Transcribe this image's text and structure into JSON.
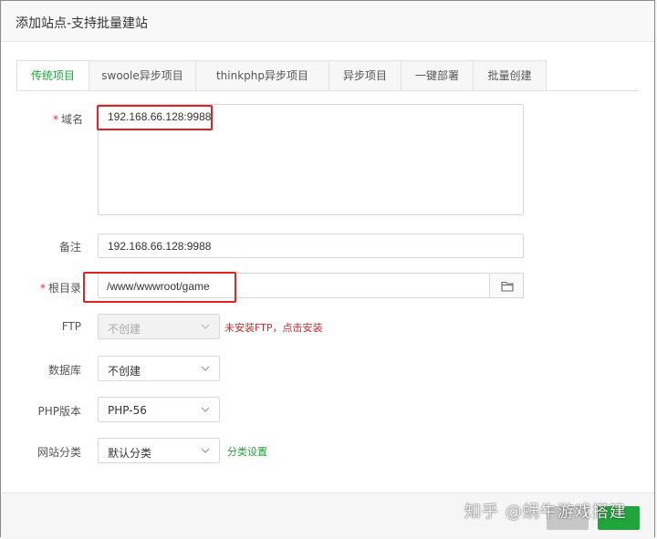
{
  "dialog": {
    "title": "添加站点-支持批量建站",
    "close_icon": "close-icon"
  },
  "tabs": [
    {
      "label": "传统项目",
      "active": true
    },
    {
      "label": "swoole异步项目",
      "active": false
    },
    {
      "label": "thinkphp异步项目",
      "active": false
    },
    {
      "label": "异步项目",
      "active": false
    },
    {
      "label": "一键部署",
      "active": false
    },
    {
      "label": "批量创建",
      "active": false
    }
  ],
  "form": {
    "required_mark": "*",
    "domain": {
      "label": "域名",
      "value": "192.168.66.128:9988"
    },
    "remark": {
      "label": "备注",
      "value": "192.168.66.128:9988"
    },
    "root_dir": {
      "label": "根目录",
      "value": "/www/wwwroot/game",
      "browse_icon": "folder-icon"
    },
    "ftp": {
      "label": "FTP",
      "selected": "不创建",
      "note": "未安装FTP，点击安装"
    },
    "database": {
      "label": "数据库",
      "selected": "不创建"
    },
    "php_version": {
      "label": "PHP版本",
      "selected": "PHP-56"
    },
    "site_category": {
      "label": "网站分类",
      "selected": "默认分类",
      "link": "分类设置"
    }
  },
  "watermark": "知乎 @蜗牛游戏搭建",
  "colors": {
    "accent": "#20a53a",
    "error": "#c8282e",
    "highlight": "#e02222"
  }
}
